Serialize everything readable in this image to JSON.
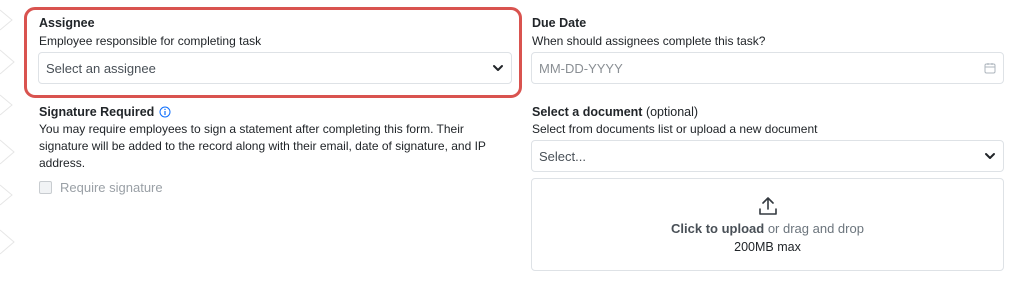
{
  "assignee": {
    "label": "Assignee",
    "description": "Employee responsible for completing task",
    "placeholder": "Select an assignee"
  },
  "due_date": {
    "label": "Due Date",
    "description": "When should assignees complete this task?",
    "placeholder": "MM-DD-YYYY"
  },
  "signature": {
    "label": "Signature Required",
    "description": "You may require employees to sign a statement after completing this form. Their signature will be added to the record along with their email, date of signature, and IP address.",
    "checkbox_label": "Require signature"
  },
  "document": {
    "label": "Select a document",
    "optional": "(optional)",
    "description": "Select from documents list or upload a new document",
    "placeholder": "Select...",
    "upload_strong": "Click to upload",
    "upload_rest": "or drag and drop",
    "upload_max": "200MB max"
  },
  "colors": {
    "highlight": "#d9534f",
    "border": "#dee2e6",
    "info": "#0d6efd"
  },
  "icons": [
    "chevron-down-icon",
    "calendar-icon",
    "info-icon",
    "upload-icon"
  ]
}
